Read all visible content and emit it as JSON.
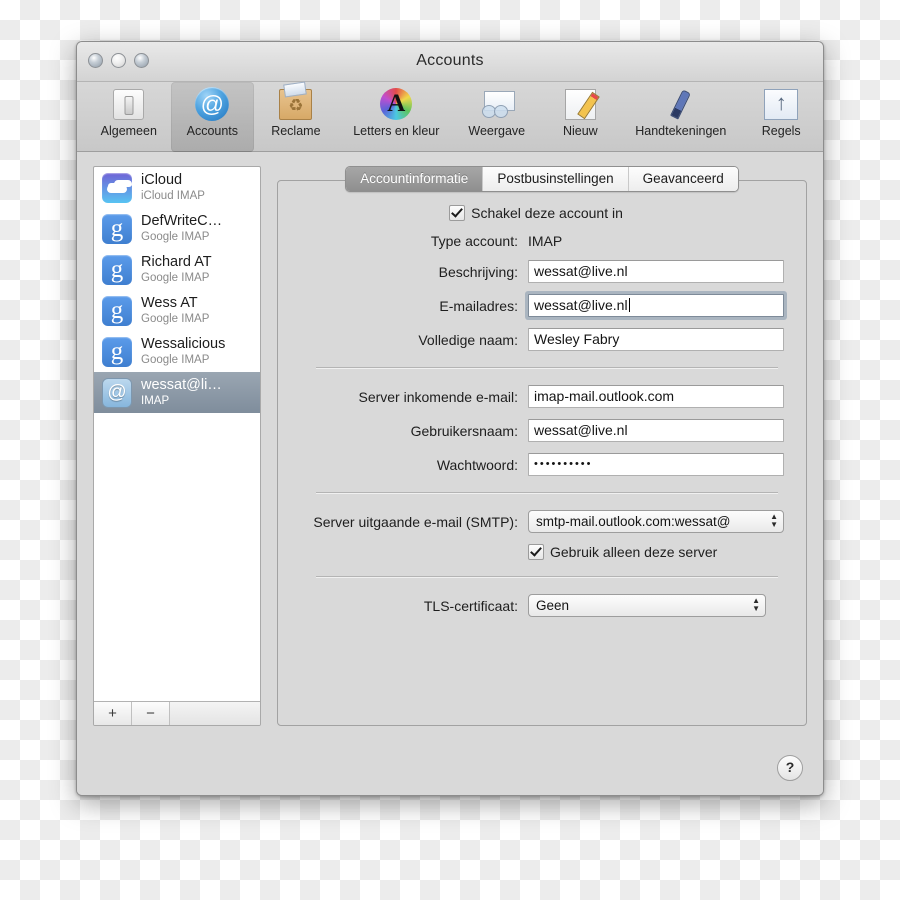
{
  "window": {
    "title": "Accounts",
    "traffic_lights": [
      "close-button",
      "minimize-button",
      "zoom-button"
    ]
  },
  "toolbar": {
    "items": [
      {
        "label": "Algemeen",
        "icon": "switch-plate-icon",
        "selected": false
      },
      {
        "label": "Accounts",
        "icon": "at-sign-icon",
        "selected": true
      },
      {
        "label": "Reclame",
        "icon": "junk-bag-icon",
        "selected": false
      },
      {
        "label": "Letters en kleur",
        "icon": "fonts-colors-icon",
        "selected": false
      },
      {
        "label": "Weergave",
        "icon": "viewing-glasses-icon",
        "selected": false
      },
      {
        "label": "Nieuw",
        "icon": "compose-pencil-icon",
        "selected": false
      },
      {
        "label": "Handtekeningen",
        "icon": "signature-pen-icon",
        "selected": false
      },
      {
        "label": "Regels",
        "icon": "rules-arrows-icon",
        "selected": false
      }
    ]
  },
  "sidebar": {
    "accounts": [
      {
        "name": "iCloud",
        "type": "iCloud IMAP",
        "icon": "icloud",
        "selected": false
      },
      {
        "name": "DefWriteC…",
        "type": "Google IMAP",
        "icon": "google",
        "selected": false
      },
      {
        "name": "Richard AT",
        "type": "Google IMAP",
        "icon": "google",
        "selected": false
      },
      {
        "name": "Wess AT",
        "type": "Google IMAP",
        "icon": "google",
        "selected": false
      },
      {
        "name": "Wessalicious",
        "type": "Google IMAP",
        "icon": "google",
        "selected": false
      },
      {
        "name": "wessat@li…",
        "type": "IMAP",
        "icon": "at",
        "selected": true
      }
    ],
    "add_label": "+",
    "remove_label": "−"
  },
  "tabs": [
    {
      "label": "Accountinformatie",
      "active": true
    },
    {
      "label": "Postbusinstellingen",
      "active": false
    },
    {
      "label": "Geavanceerd",
      "active": false
    }
  ],
  "form": {
    "enable_account": {
      "label": "Schakel deze account in",
      "checked": true
    },
    "account_type": {
      "label": "Type account:",
      "value": "IMAP"
    },
    "description": {
      "label": "Beschrijving:",
      "value": "wessat@live.nl"
    },
    "email": {
      "label": "E-mailadres:",
      "value": "wessat@live.nl",
      "focused": true
    },
    "full_name": {
      "label": "Volledige naam:",
      "value": "Wesley Fabry"
    },
    "incoming_server": {
      "label": "Server inkomende e-mail:",
      "value": "imap-mail.outlook.com"
    },
    "username": {
      "label": "Gebruikersnaam:",
      "value": "wessat@live.nl"
    },
    "password": {
      "label": "Wachtwoord:",
      "value": "••••••••••"
    },
    "smtp": {
      "label": "Server uitgaande e-mail (SMTP):",
      "value": "smtp-mail.outlook.com:wessat@"
    },
    "smtp_only": {
      "label": "Gebruik alleen deze server",
      "checked": true
    },
    "tls": {
      "label": "TLS-certificaat:",
      "value": "Geen"
    }
  },
  "help": {
    "label": "?"
  }
}
